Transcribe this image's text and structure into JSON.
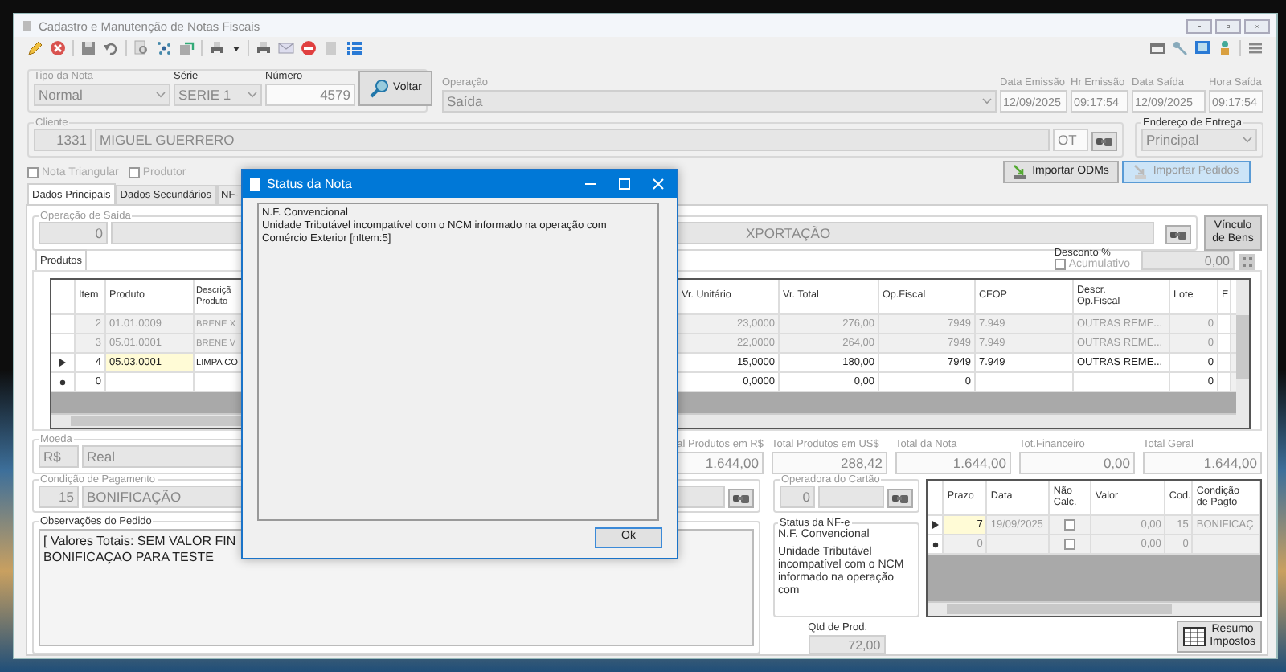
{
  "window": {
    "title": "Cadastro e Manutenção de Notas Fiscais"
  },
  "header": {
    "tipo_da_nota": {
      "label": "Tipo da Nota",
      "value": "Normal"
    },
    "serie": {
      "label": "Série",
      "value": "SERIE 1"
    },
    "numero": {
      "label": "Número",
      "value": "4579"
    },
    "voltar_button": "Voltar",
    "operacao": {
      "label": "Operação",
      "value": "Saída"
    },
    "dates": [
      {
        "label": "Data Emissão",
        "value": "12/09/2025"
      },
      {
        "label": "Hr Emissão",
        "value": "09:17:54"
      },
      {
        "label": "Data Saída",
        "value": "12/09/2025"
      },
      {
        "label": "Hora Saída",
        "value": "09:17:54"
      }
    ]
  },
  "cliente": {
    "label": "Cliente",
    "code": "1331",
    "name": "MIGUEL GUERRERO",
    "suffix": "OT"
  },
  "endereco_de_entrega": {
    "label": "Endereço de Entrega",
    "value": "Principal"
  },
  "checkboxes": [
    {
      "label": "Nota Triangular",
      "checked": false
    },
    {
      "label": "Produtor",
      "checked": false
    }
  ],
  "import_buttons": [
    {
      "label": "Importar ODMs",
      "highlighted": false,
      "disabled": false
    },
    {
      "label": "Importar Pedidos",
      "highlighted": true,
      "disabled": true
    }
  ],
  "tabs": [
    {
      "label": "Dados Principais",
      "selected": true
    },
    {
      "label": "Dados Secundários",
      "selected": false
    },
    {
      "label": "NF-",
      "selected": false
    }
  ],
  "operacao_de_saida": {
    "label": "Operação de Saída",
    "code": "0",
    "name": "XPORTAÇÃO"
  },
  "vinculo_button": "Vínculo\nde Bens",
  "desconto": {
    "label": "Desconto %",
    "checkbox_label": "Acumulativo",
    "checked": false,
    "value": "0,00"
  },
  "products_tab": {
    "label": "Produtos",
    "selected": true
  },
  "products_table": {
    "columns": [
      "Item",
      "Produto",
      "Descriçã\nProduto",
      "Vr. Unitário",
      "Vr. Total",
      "Op.Fiscal",
      "CFOP",
      "Descr.\nOp.Fiscal",
      "Lote",
      "E"
    ],
    "rows": [
      {
        "selected": false,
        "new_row": false,
        "item": "2",
        "produto": "01.01.0009",
        "descricao": "BRENE X",
        "vr_unitario": "23,0000",
        "vr_total": "276,00",
        "op_fiscal": "7949",
        "cfop": "7.949",
        "descr_op_fiscal": "OUTRAS REME...",
        "lote": "0"
      },
      {
        "selected": false,
        "new_row": false,
        "item": "3",
        "produto": "05.01.0001",
        "descricao": "BRENE V",
        "vr_unitario": "22,0000",
        "vr_total": "264,00",
        "op_fiscal": "7949",
        "cfop": "7.949",
        "descr_op_fiscal": "OUTRAS REME...",
        "lote": "0"
      },
      {
        "selected": true,
        "new_row": false,
        "item": "4",
        "produto": "05.03.0001",
        "descricao": "LIMPA CO",
        "vr_unitario": "15,0000",
        "vr_total": "180,00",
        "op_fiscal": "7949",
        "cfop": "7.949",
        "descr_op_fiscal": "OUTRAS REME...",
        "lote": "0"
      },
      {
        "selected": false,
        "new_row": true,
        "item": "0",
        "vr_unitario": "0,0000",
        "vr_total": "0,00",
        "op_fiscal": "0",
        "lote": "0"
      }
    ]
  },
  "totals": [
    {
      "label": "al Produtos em R$",
      "value": "1.644,00"
    },
    {
      "label": "Total Produtos em US$",
      "value": "288,42"
    },
    {
      "label": "Total da Nota",
      "value": "1.644,00"
    },
    {
      "label": "Tot.Financeiro",
      "value": "0,00"
    },
    {
      "label": "Total Geral",
      "value": "1.644,00"
    }
  ],
  "moeda": {
    "label": "Moeda",
    "code": "R$",
    "name": "Real"
  },
  "condicao_de_pagamento": {
    "label": "Condição de Pagamento",
    "code": "15",
    "name": "BONIFICAÇÃO"
  },
  "observacoes": {
    "label": "Observações do Pedido",
    "text": "[ Valores Totais: SEM VALOR FIN\nBONIFICAÇAO PARA TESTE"
  },
  "operadora_do_cartao": {
    "label": "Operadora do Cartão",
    "code": "0"
  },
  "status_nfe": {
    "label": "Status da NF-e",
    "status": "N.F. Convencional",
    "message": "Unidade Tributável incompatível com o NCM informado na operação com"
  },
  "qtd_de_prod": {
    "label": "Qtd de Prod.",
    "value": "72,00"
  },
  "payments_table": {
    "columns": [
      "Prazo",
      "Data",
      "Não\nCalc.",
      "Valor",
      "Cod.",
      "Condição\nde Pagto"
    ],
    "rows": [
      {
        "selected": true,
        "new_row": false,
        "prazo": "7",
        "data": "19/09/2025",
        "nao_calc": false,
        "valor": "0,00",
        "cod": "15",
        "condicao": "BONIFICAÇ"
      },
      {
        "selected": false,
        "new_row": true,
        "prazo": "0",
        "nao_calc": false,
        "valor": "0,00",
        "cod": "0"
      }
    ]
  },
  "resumo_button": "Resumo\nImpostos",
  "dialog": {
    "title": "Status da Nota",
    "message": "N.F. Convencional\nUnidade Tributável incompatível com o NCM informado na operação com Comércio Exterior [nItem:5]",
    "ok_button": "Ok"
  }
}
